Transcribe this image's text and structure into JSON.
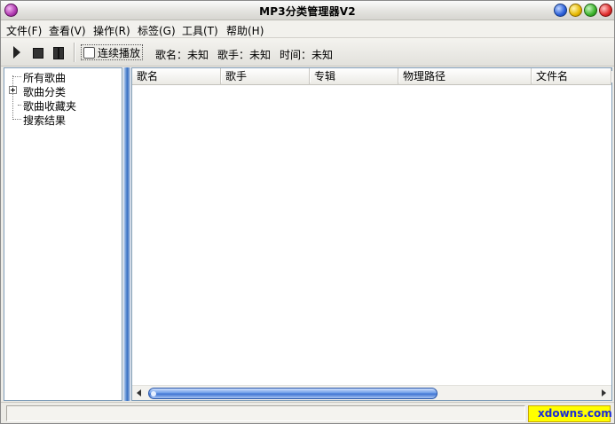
{
  "window": {
    "title": "MP3分类管理器V2"
  },
  "menu": [
    {
      "label": "文件(F)"
    },
    {
      "label": "查看(V)"
    },
    {
      "label": "操作(R)"
    },
    {
      "label": "标签(G)"
    },
    {
      "label": "工具(T)"
    },
    {
      "label": "帮助(H)"
    }
  ],
  "toolbar": {
    "continuous_label": "连续播放",
    "continuous_checked": false,
    "song": "歌名：未知",
    "artist": "歌手：未知",
    "time": "时间：未知",
    "icons": [
      "play-icon",
      "stop-icon",
      "pause-icon"
    ]
  },
  "tree": {
    "items": [
      {
        "label": "所有歌曲"
      },
      {
        "label": "歌曲分类",
        "expandable": true
      },
      {
        "label": "歌曲收藏夹"
      },
      {
        "label": "搜索结果"
      }
    ]
  },
  "list": {
    "columns": [
      {
        "label": "歌名"
      },
      {
        "label": "歌手"
      },
      {
        "label": "专辑"
      },
      {
        "label": "物理路径"
      },
      {
        "label": "文件名"
      }
    ],
    "rows": []
  },
  "status": {
    "text": "",
    "brand": "xdowns.com",
    "brand_color": "#1b2bd6",
    "brand_bg": "#ffff00"
  },
  "colors": {
    "accent": "#3f74d3"
  }
}
